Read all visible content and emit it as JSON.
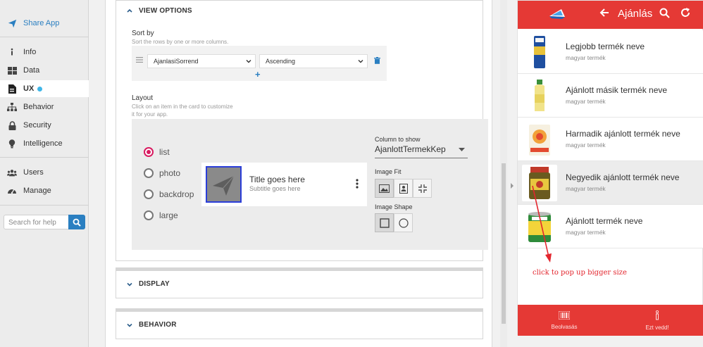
{
  "nav": {
    "share": "Share App",
    "items": [
      {
        "label": "Info",
        "icon": "info-icon"
      },
      {
        "label": "Data",
        "icon": "table-icon"
      },
      {
        "label": "UX",
        "icon": "ux-doc-icon"
      },
      {
        "label": "Behavior",
        "icon": "hierarchy-icon"
      },
      {
        "label": "Security",
        "icon": "lock-icon"
      },
      {
        "label": "Intelligence",
        "icon": "lightbulb-icon"
      },
      {
        "label": "Users",
        "icon": "users-icon"
      },
      {
        "label": "Manage",
        "icon": "gauge-icon"
      }
    ],
    "search_placeholder": "Search for help"
  },
  "view_options": {
    "heading": "VIEW OPTIONS",
    "sort_by": "Sort by",
    "sort_help": "Sort the rows by one or more columns.",
    "sort_column": "AjanlasiSorrend",
    "sort_order": "Ascending",
    "add_symbol": "+",
    "layout_label": "Layout",
    "layout_help_1": "Click on an item in the card to customize",
    "layout_help_2": "it for your app.",
    "layout_options": [
      "list",
      "photo",
      "backdrop",
      "large"
    ],
    "selected_layout": "list",
    "preview_title": "Title goes here",
    "preview_subtitle": "Subtitle goes here",
    "column_to_show_label": "Column to show",
    "column_to_show_value": "AjanlottTermekKep",
    "image_fit_label": "Image Fit",
    "image_shape_label": "Image Shape"
  },
  "sections": {
    "display": "DISPLAY",
    "behavior": "BEHAVIOR"
  },
  "phone": {
    "title": "Ajánlás",
    "items": [
      {
        "title": "Legjobb termék neve",
        "subtitle": "magyar termék"
      },
      {
        "title": "Ajánlott másik termék neve",
        "subtitle": "magyar termék"
      },
      {
        "title": "Harmadik ajánlott termék neve",
        "subtitle": "magyar termék"
      },
      {
        "title": "Negyedik ajánlott termék neve",
        "subtitle": "magyar termék"
      },
      {
        "title": "Ajánlott termék neve",
        "subtitle": "magyar termék"
      }
    ],
    "footer": [
      {
        "label": "Beolvasás"
      },
      {
        "label": "Ezt vedd!"
      }
    ]
  },
  "annotation": "click to pop up bigger size",
  "colors": {
    "accent": "#e53935",
    "nav_accent": "#2a7fc1",
    "radio": "#d81b60"
  }
}
